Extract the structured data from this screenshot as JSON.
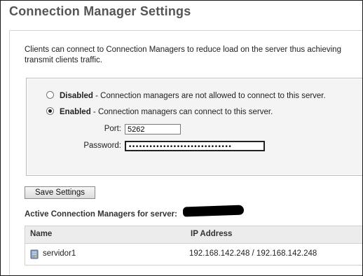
{
  "page": {
    "title": "Connection Manager Settings",
    "intro": "Clients can connect to Connection Managers to reduce load on the server thus achieving",
    "intro_line2": "transmit clients traffic."
  },
  "options": {
    "disabled": {
      "label": "Disabled",
      "description": " - Connection managers are not allowed to connect to this server.",
      "selected": false
    },
    "enabled": {
      "label": "Enabled",
      "description": " - Connection managers can connect to this server.",
      "selected": true
    }
  },
  "fields": {
    "port_label": "Port:",
    "port_value": "5262",
    "password_label": "Password:",
    "password_value": "••••••••••••••••••••••••••••••"
  },
  "buttons": {
    "save": "Save Settings"
  },
  "active_managers": {
    "heading": "Active Connection Managers for server:",
    "columns": [
      "Name",
      "IP Address"
    ],
    "rows": [
      {
        "name": "servidor1",
        "ip": "192.168.142.248 / 192.168.142.248",
        "icon": "server-icon"
      }
    ]
  }
}
